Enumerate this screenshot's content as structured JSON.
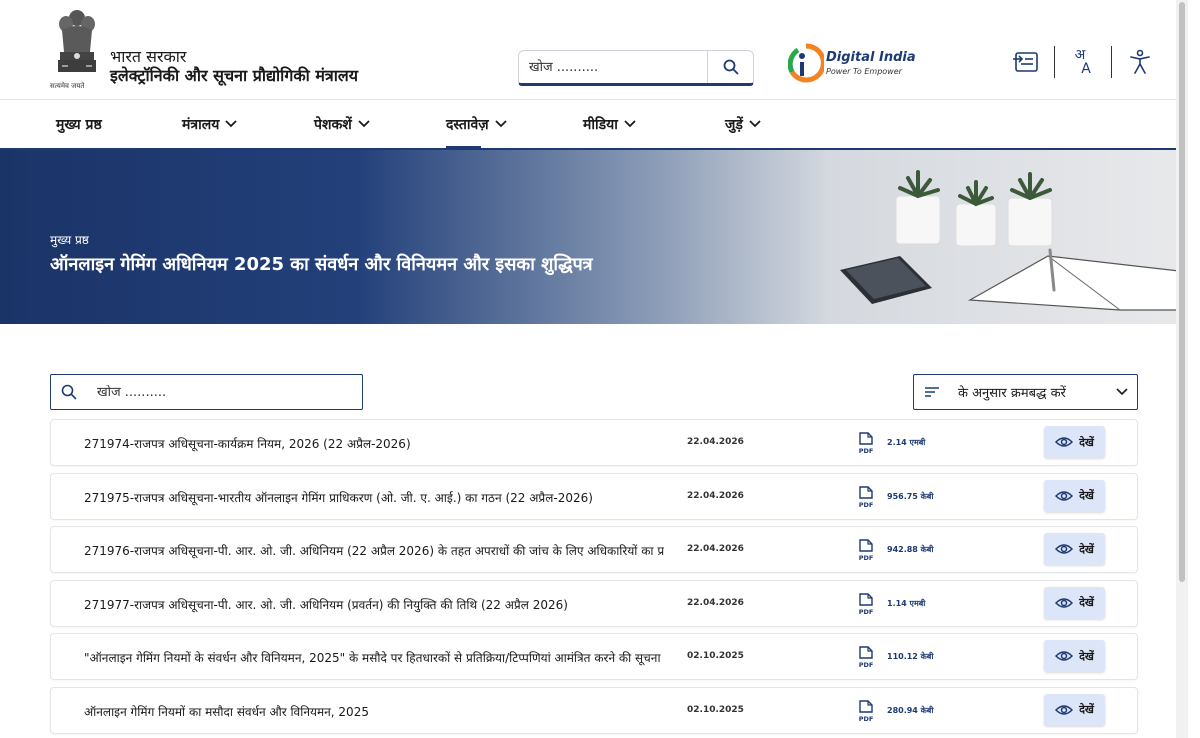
{
  "header": {
    "emblem_motto": "सत्यमेव जयते",
    "gov_line1": "भारत सरकार",
    "gov_line2": "इलेक्ट्रॉनिकी और सूचना प्रौद्योगिकी मंत्रालय",
    "search_placeholder": "खोज ..........",
    "digital_india_title": "Digital India",
    "digital_india_subtitle": "Power To Empower",
    "icons": [
      "screen-reader-icon",
      "language-icon",
      "accessibility-icon"
    ],
    "language_glyph_top": "अ",
    "language_glyph_bottom": "A"
  },
  "nav": {
    "items": [
      {
        "label": "मुख्य प्रष्ठ",
        "dropdown": false,
        "active": false
      },
      {
        "label": "मंत्रालय",
        "dropdown": true,
        "active": false
      },
      {
        "label": "पेशकशें",
        "dropdown": true,
        "active": false
      },
      {
        "label": "दस्तावेज़",
        "dropdown": true,
        "active": true
      },
      {
        "label": "मीडिया",
        "dropdown": true,
        "active": false
      },
      {
        "label": "जुड़ें",
        "dropdown": true,
        "active": false
      }
    ]
  },
  "banner": {
    "breadcrumb": "मुख्य प्रष्ठ",
    "title": "ऑनलाइन गेमिंग अधिनियम 2025 का संवर्धन और विनियमन और इसका शुद्धिपत्र"
  },
  "list": {
    "search_placeholder": "खोज ..........",
    "sort_label": "के अनुसार क्रमबद्ध करें",
    "view_label": "देखें",
    "file_type": "PDF",
    "rows": [
      {
        "title": "271974-राजपत्र अधिसूचना-कार्यक्रम नियम, 2026 (22 अप्रैल-2026)",
        "date": "22.04.2026",
        "size": "2.14 एमबी"
      },
      {
        "title": "271975-राजपत्र अधिसूचना-भारतीय ऑनलाइन गेमिंग प्राधिकरण (ओ. जी. ए. आई.) का गठन (22 अप्रैल-2026)",
        "date": "22.04.2026",
        "size": "956.75 केबी"
      },
      {
        "title": "271976-राजपत्र अधिसूचना-पी. आर. ओ. जी. अधिनियम (22 अप्रैल 2026) के तहत अपराधों की जांच के लिए अधिकारियों का प्राधिकरण",
        "date": "22.04.2026",
        "size": "942.88 केबी"
      },
      {
        "title": "271977-राजपत्र अधिसूचना-पी. आर. ओ. जी. अधिनियम (प्रवर्तन) की नियुक्ति की तिथि (22 अप्रैल 2026)",
        "date": "22.04.2026",
        "size": "1.14 एमबी"
      },
      {
        "title": "\"ऑनलाइन गेमिंग नियमों के संवर्धन और विनियमन, 2025\" के मसौदे पर हितधारकों से प्रतिक्रिया/टिप्पणियां आमंत्रित करने की सूचना दें",
        "date": "02.10.2025",
        "size": "110.12 केबी"
      },
      {
        "title": "ऑनलाइन गेमिंग नियमों का मसौदा संवर्धन और विनियमन, 2025",
        "date": "02.10.2025",
        "size": "280.94 केबी"
      }
    ]
  },
  "colors": {
    "brand_navy": "#1d3a73",
    "view_button_bg": "#dde6f8",
    "di_orange": "#f58220",
    "di_green": "#2aa94a"
  }
}
